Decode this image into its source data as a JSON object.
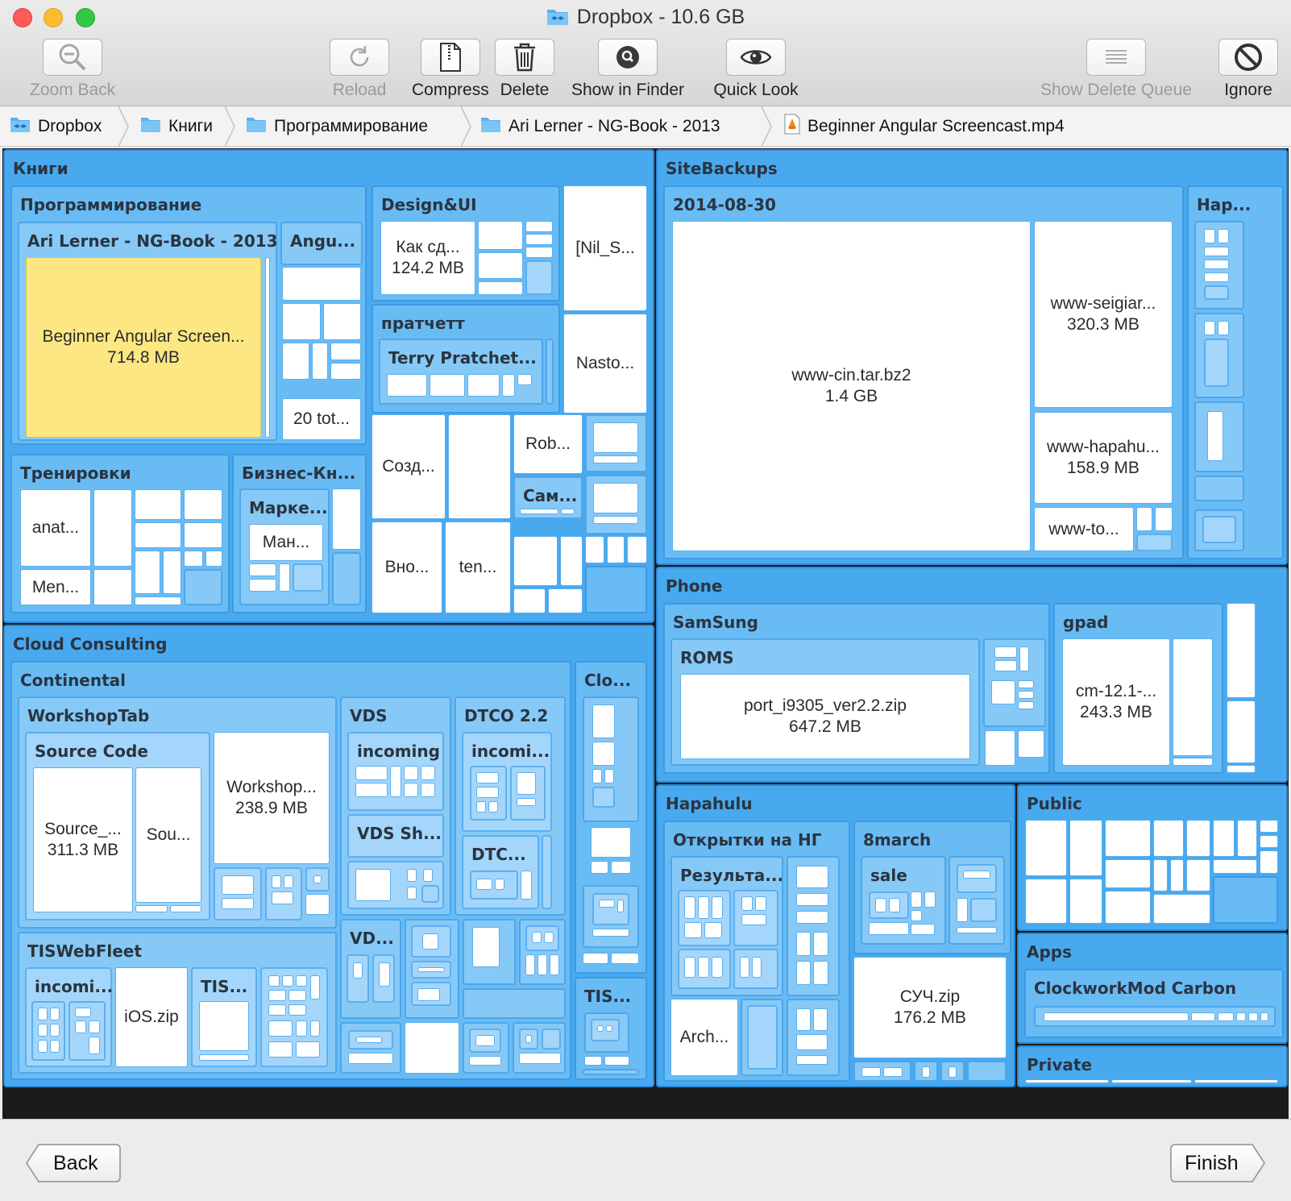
{
  "window": {
    "title": "Dropbox - 10.6 GB"
  },
  "toolbar": {
    "zoom_back": "Zoom Back",
    "reload": "Reload",
    "compress": "Compress",
    "delete": "Delete",
    "show_in_finder": "Show in Finder",
    "quick_look": "Quick Look",
    "show_delete_queue": "Show Delete Queue",
    "ignore": "Ignore"
  },
  "path": [
    "Dropbox",
    "Книги",
    "Программирование",
    "Ari Lerner - NG-Book - 2013",
    "Beginner Angular Screencast.mp4"
  ],
  "treemap": {
    "knigi": "Книги",
    "programming": "Программирование",
    "ng_book": "Ari Lerner - NG-Book - 2013",
    "angu": "Angu...",
    "selected_file": {
      "name": "Beginner Angular Screen...",
      "size": "714.8 MB"
    },
    "twenty_tot": "20 tot...",
    "design_ui": "Design&UI",
    "kak_sd": {
      "name": "Как сд...",
      "size": "124.2 MB"
    },
    "nil_s": "[Nil_S...",
    "nasto": "Nasto...",
    "pratchett": "пратчетт",
    "terry": "Terry Pratchet...",
    "sozd": "Созд...",
    "rob": "Rob...",
    "sam": "Сам...",
    "vno": "Вно...",
    "ten": "ten...",
    "trenirovki": "Тренировки",
    "anat": "anat...",
    "men": "Men...",
    "biznes": "Бизнес-Кн...",
    "marke": "Марке...",
    "man": "Ман...",
    "sitebackups": "SiteBackups",
    "date_folder": "2014-08-30",
    "hap": "Hap...",
    "www_cin": {
      "name": "www-cin.tar.bz2",
      "size": "1.4 GB"
    },
    "www_seigiar": {
      "name": "www-seigiar...",
      "size": "320.3 MB"
    },
    "www_hapahu": {
      "name": "www-hapahu...",
      "size": "158.9 MB"
    },
    "www_to": "www-to...",
    "phone": "Phone",
    "samsung": "SamSung",
    "roms": "ROMS",
    "port_zip": {
      "name": "port_i9305_ver2.2.zip",
      "size": "647.2 MB"
    },
    "gpad": "gpad",
    "cm": {
      "name": "cm-12.1-...",
      "size": "243.3 MB"
    },
    "hapahulu": "Hapahulu",
    "otkrytki": "Открытки на НГ",
    "rezulta": "Результа...",
    "arch": "Arch...",
    "march": "8march",
    "sale": "sale",
    "such": {
      "name": "СУЧ.zip",
      "size": "176.2 MB"
    },
    "public": "Public",
    "apps": "Apps",
    "clockwork": "ClockworkMod Carbon",
    "private": "Private",
    "cloud": "Cloud Consulting",
    "continental": "Continental",
    "clo": "Clo...",
    "workshoptab": "WorkshopTab",
    "source_code": "Source Code",
    "source_file": {
      "name": "Source_...",
      "size": "311.3 MB"
    },
    "sou": "Sou...",
    "workshop_file": {
      "name": "Workshop...",
      "size": "238.9 MB"
    },
    "vds": "VDS",
    "incoming": "incoming",
    "vds_sh": "VDS Sh...",
    "dtco": "DTCO 2.2",
    "incomi": "incomi...",
    "dtc": "DTC...",
    "vd": "VD...",
    "tiswebfleet": "TISWebFleet",
    "incomi2": "incomi...",
    "ios": "iOS.zip",
    "tis": "TIS...",
    "tis2": "TIS..."
  },
  "bottom": {
    "back": "Back",
    "finish": "Finish"
  },
  "colors": {
    "selection": "#fce783",
    "level1": "#48a9ef",
    "level2": "#69bbf4",
    "level3": "#86c9f7",
    "file": "#ffffff"
  }
}
